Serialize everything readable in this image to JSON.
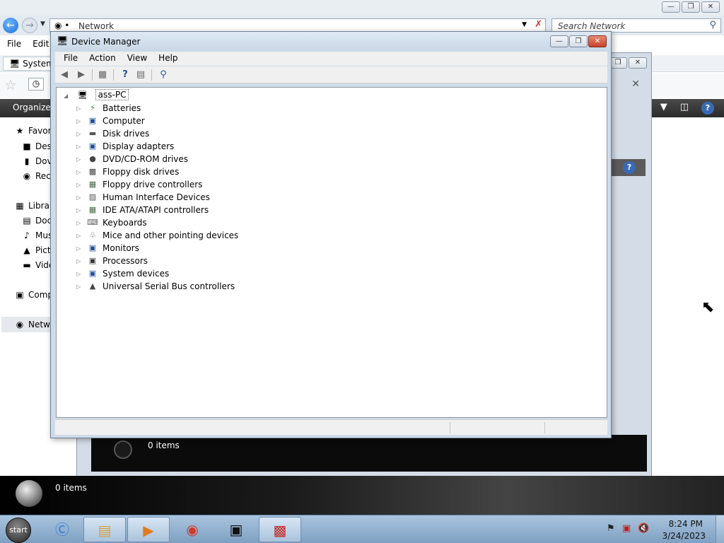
{
  "explorer": {
    "address_text": "Network",
    "search_placeholder": "Search Network",
    "menu": [
      "File",
      "Edit"
    ],
    "system_tab": "System",
    "command": {
      "organize": "Organize"
    },
    "nav": [
      "Favor",
      "Des",
      "Dov",
      "Rec",
      "Librar",
      "Doc",
      "Mus",
      "Pict",
      "Vide",
      "Comp",
      "Netwo"
    ],
    "status_items": "0 items"
  },
  "window2": {
    "items": "0 items"
  },
  "device_manager": {
    "title": "Device Manager",
    "menu": [
      "File",
      "Action",
      "View",
      "Help"
    ],
    "root": "ass-PC",
    "devices": [
      {
        "label": "Batteries",
        "icon": "battery-icon"
      },
      {
        "label": "Computer",
        "icon": "computer-icon"
      },
      {
        "label": "Disk drives",
        "icon": "disk-drive-icon"
      },
      {
        "label": "Display adapters",
        "icon": "display-adapter-icon"
      },
      {
        "label": "DVD/CD-ROM drives",
        "icon": "dvd-drive-icon"
      },
      {
        "label": "Floppy disk drives",
        "icon": "floppy-drive-icon"
      },
      {
        "label": "Floppy drive controllers",
        "icon": "floppy-controller-icon"
      },
      {
        "label": "Human Interface Devices",
        "icon": "hid-icon"
      },
      {
        "label": "IDE ATA/ATAPI controllers",
        "icon": "ide-controller-icon"
      },
      {
        "label": "Keyboards",
        "icon": "keyboard-icon"
      },
      {
        "label": "Mice and other pointing devices",
        "icon": "mouse-icon"
      },
      {
        "label": "Monitors",
        "icon": "monitor-icon"
      },
      {
        "label": "Processors",
        "icon": "processor-icon"
      },
      {
        "label": "System devices",
        "icon": "system-devices-icon"
      },
      {
        "label": "Universal Serial Bus controllers",
        "icon": "usb-icon"
      }
    ]
  },
  "taskbar": {
    "start_label": "start",
    "time": "8:24 PM",
    "date": "3/24/2023",
    "apps": [
      "internet-explorer-icon",
      "file-explorer-icon",
      "media-player-icon",
      "chrome-icon",
      "terminal-icon",
      "toolbox-icon"
    ]
  }
}
